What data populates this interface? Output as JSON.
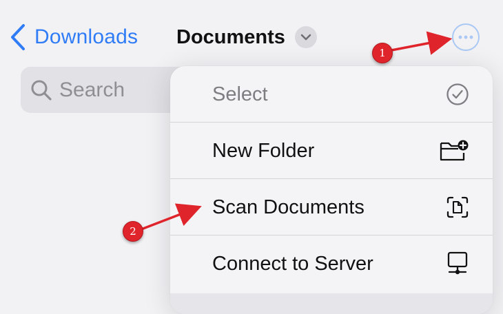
{
  "nav": {
    "back_label": "Downloads",
    "title": "Documents"
  },
  "search": {
    "placeholder": "Search"
  },
  "menu": {
    "items": [
      {
        "label": "Select",
        "icon": "checkmark-circle-icon",
        "enabled": false
      },
      {
        "label": "New Folder",
        "icon": "folder-plus-icon",
        "enabled": true
      },
      {
        "label": "Scan Documents",
        "icon": "scan-document-icon",
        "enabled": true
      },
      {
        "label": "Connect to Server",
        "icon": "server-display-icon",
        "enabled": true
      }
    ]
  },
  "annotations": [
    {
      "number": "1",
      "target": "more-options-button"
    },
    {
      "number": "2",
      "target": "menu-item-scan-documents"
    }
  ],
  "colors": {
    "accent": "#2f7cf6",
    "annotation_red": "#e0242b"
  }
}
